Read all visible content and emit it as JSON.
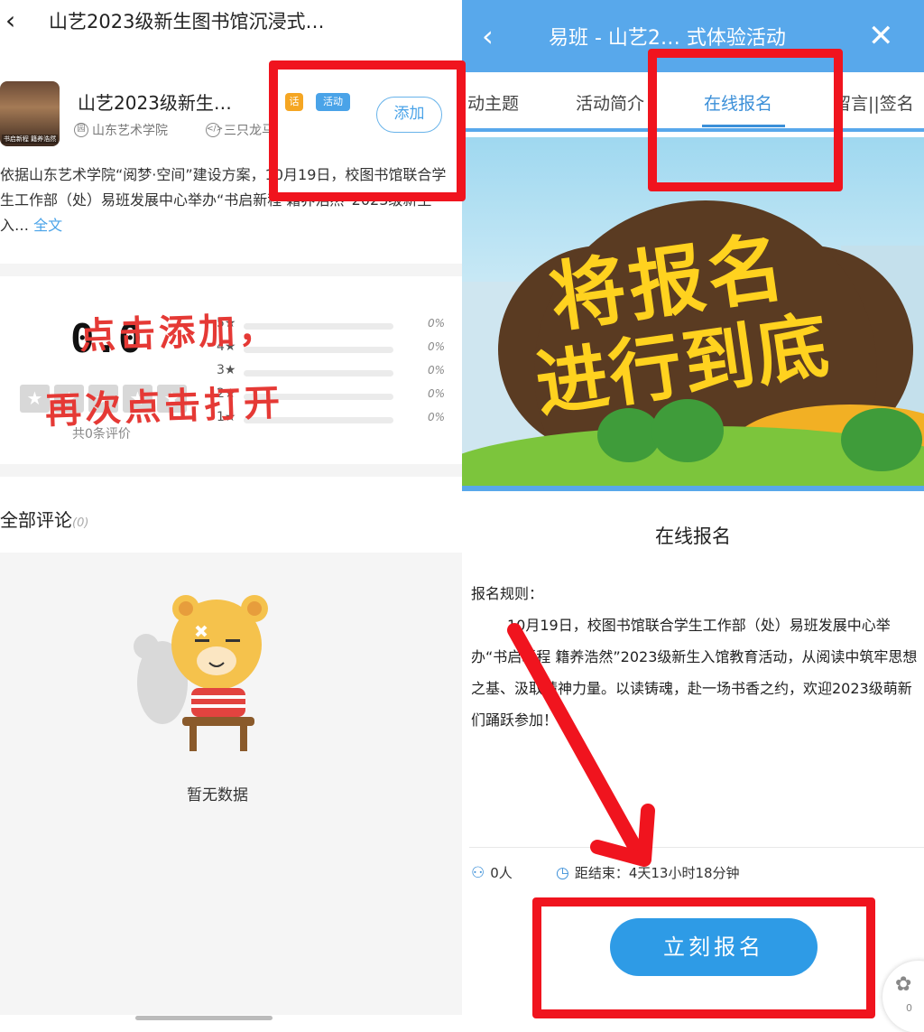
{
  "left": {
    "back_icon": "‹",
    "title": "山艺2023级新生图书馆沉浸式…",
    "thumb_caption": "书启新程 籍养浩然",
    "name": "山艺2023级新生…",
    "tag_orange": "话",
    "tag_blue": "活动",
    "add_button": "添加",
    "school": "山东艺术学院",
    "organizer": "三只龙马",
    "intro_text": "依据山东艺术学院“阅梦·空间”建设方案，10月19日，校图书馆联合学生工作部（处）易班发展中心举办“书启新程 籍养浩然”2023级新生入…",
    "intro_more": "全文",
    "score": "0.0",
    "total_reviews": "共0条评价",
    "ratings": [
      {
        "label": "5★",
        "pct": "0%"
      },
      {
        "label": "4★",
        "pct": "0%"
      },
      {
        "label": "3★",
        "pct": "0%"
      },
      {
        "label": "2★",
        "pct": "0%"
      },
      {
        "label": "1★",
        "pct": "0%"
      }
    ],
    "annotation_line1": "点击添加，",
    "annotation_line2": "再次点击打开",
    "comments_title": "全部评论",
    "comments_count": "(0)",
    "empty_text": "暂无数据"
  },
  "right": {
    "back_icon": "‹",
    "title": "易班 - 山艺2… 式体验活动",
    "close_icon": "✕",
    "tabs": [
      "动主题",
      "活动简介",
      "在线报名",
      "留言||签名"
    ],
    "active_tab": "在线报名",
    "banner_line1": "将报名",
    "banner_line2": "进行到底",
    "section_title": "在线报名",
    "rules_head": "报名规则：",
    "rules_body": "10月19日，校图书馆联合学生工作部（处）易班发展中心举办“书启新程 籍养浩然”2023级新生入馆教育活动，从阅读中筑牢思想之基、汲取精神力量。以读铸魂，赴一场书香之约，欢迎2023级萌新们踊跃参加！",
    "participants": "0人",
    "deadline": "距结束：4天13小时18分钟",
    "signup_button": "立刻报名",
    "float_count": "0"
  },
  "colors": {
    "accent_blue": "#58a8eb",
    "button_blue": "#2e9be6",
    "annotation_red": "#f0141e",
    "banner_yellow": "#ffd21f"
  }
}
